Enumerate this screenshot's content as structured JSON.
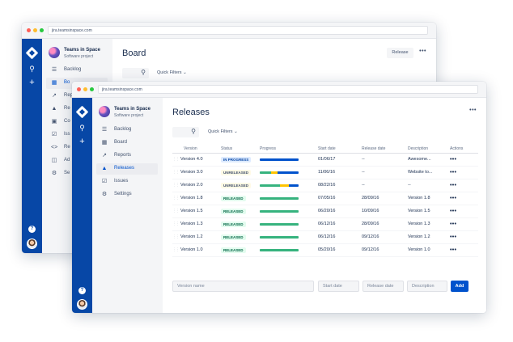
{
  "back_window": {
    "url": "jira.teamsinspace.com",
    "project_name": "Teams in Space",
    "project_type": "Software project",
    "nav": [
      {
        "label": "Backlog",
        "icon": "backlog-icon"
      },
      {
        "label": "Board",
        "icon": "board-icon"
      },
      {
        "label": "Reports",
        "icon": "reports-icon"
      },
      {
        "label": "Releases",
        "icon": "releases-icon"
      },
      {
        "label": "Components",
        "icon": "components-icon"
      },
      {
        "label": "Issues",
        "icon": "issues-icon"
      },
      {
        "label": "Repository",
        "icon": "code-icon"
      },
      {
        "label": "Add-ons",
        "icon": "add-ons-icon"
      },
      {
        "label": "Settings",
        "icon": "gear-icon"
      }
    ],
    "nav_visible": [
      "Backlog",
      "Bo",
      "Repo",
      "Re",
      "Co",
      "Iss",
      "Re",
      "Ad",
      "Se"
    ],
    "title": "Board",
    "quick_filters": "Quick Filters",
    "release_button": "Release"
  },
  "front_window": {
    "url": "jira.teamsinspace.com",
    "project_name": "Teams in Space",
    "project_type": "Software project",
    "nav": [
      {
        "label": "Backlog",
        "icon": "backlog-icon"
      },
      {
        "label": "Board",
        "icon": "board-icon"
      },
      {
        "label": "Reports",
        "icon": "reports-icon"
      },
      {
        "label": "Releases",
        "icon": "releases-icon"
      },
      {
        "label": "Issues",
        "icon": "issues-icon"
      },
      {
        "label": "Settings",
        "icon": "gear-icon"
      }
    ],
    "title": "Releases",
    "quick_filters": "Quick Filters",
    "columns": [
      "Version",
      "Status",
      "Progress",
      "Start date",
      "Release date",
      "Description",
      "Actions"
    ],
    "rows": [
      {
        "version": "Version 4.0",
        "status": "IN PROGRESS",
        "status_kind": "inprogress",
        "progress": {
          "done": 0.0,
          "inprogress": 1.0,
          "todo": 0.0
        },
        "start": "01/06/17",
        "release": "--",
        "description": "Awesome...",
        "actions": "•••"
      },
      {
        "version": "Version 3.0",
        "status": "UNRELEASED",
        "status_kind": "unreleased",
        "progress": {
          "done": 0.3,
          "inprogress": 0.15,
          "todo": 0.55
        },
        "start": "11/06/16",
        "release": "--",
        "description": "Website to...",
        "actions": "•••"
      },
      {
        "version": "Version 2.0",
        "status": "UNRELEASED",
        "status_kind": "unreleased",
        "progress": {
          "done": 0.52,
          "inprogress": 0.22,
          "todo": 0.26
        },
        "start": "08/22/16",
        "release": "--",
        "description": "--",
        "actions": "•••"
      },
      {
        "version": "Version 1.8",
        "status": "RELEASED",
        "status_kind": "released",
        "progress": {
          "done": 1.0,
          "inprogress": 0.0,
          "todo": 0.0
        },
        "start": "07/05/16",
        "release": "28/09/16",
        "description": "Version 1.8",
        "actions": "•••"
      },
      {
        "version": "Version 1.5",
        "status": "RELEASED",
        "status_kind": "released",
        "progress": {
          "done": 1.0,
          "inprogress": 0.0,
          "todo": 0.0
        },
        "start": "06/20/16",
        "release": "10/09/16",
        "description": "Version 1.5",
        "actions": "•••"
      },
      {
        "version": "Version 1.3",
        "status": "RELEASED",
        "status_kind": "released",
        "progress": {
          "done": 1.0,
          "inprogress": 0.0,
          "todo": 0.0
        },
        "start": "06/12/16",
        "release": "28/09/16",
        "description": "Version 1.3",
        "actions": "•••"
      },
      {
        "version": "Version 1.2",
        "status": "RELEASED",
        "status_kind": "released",
        "progress": {
          "done": 1.0,
          "inprogress": 0.0,
          "todo": 0.0
        },
        "start": "06/12/16",
        "release": "09/12/16",
        "description": "Version 1.2",
        "actions": "•••"
      },
      {
        "version": "Version 1.0",
        "status": "RELEASED",
        "status_kind": "released",
        "progress": {
          "done": 1.0,
          "inprogress": 0.0,
          "todo": 0.0
        },
        "start": "05/20/16",
        "release": "09/12/16",
        "description": "Version 1.0",
        "actions": "•••"
      }
    ],
    "add_row": {
      "version_placeholder": "Version name",
      "start_placeholder": "Start date",
      "release_placeholder": "Release date",
      "description_placeholder": "Description",
      "add_label": "Add"
    }
  },
  "global_nav": {
    "icons": [
      "logo-icon",
      "search-icon",
      "plus-icon",
      "help-icon",
      "avatar"
    ],
    "help": "?"
  },
  "colors": {
    "global_nav": "#0747a6",
    "progress_done": "#36b37e",
    "progress_inprogress": "#0052cc",
    "progress_unreleased_mid": "#ffc400",
    "progress_todo": "#dfe1e6",
    "add_button": "#0052cc"
  }
}
